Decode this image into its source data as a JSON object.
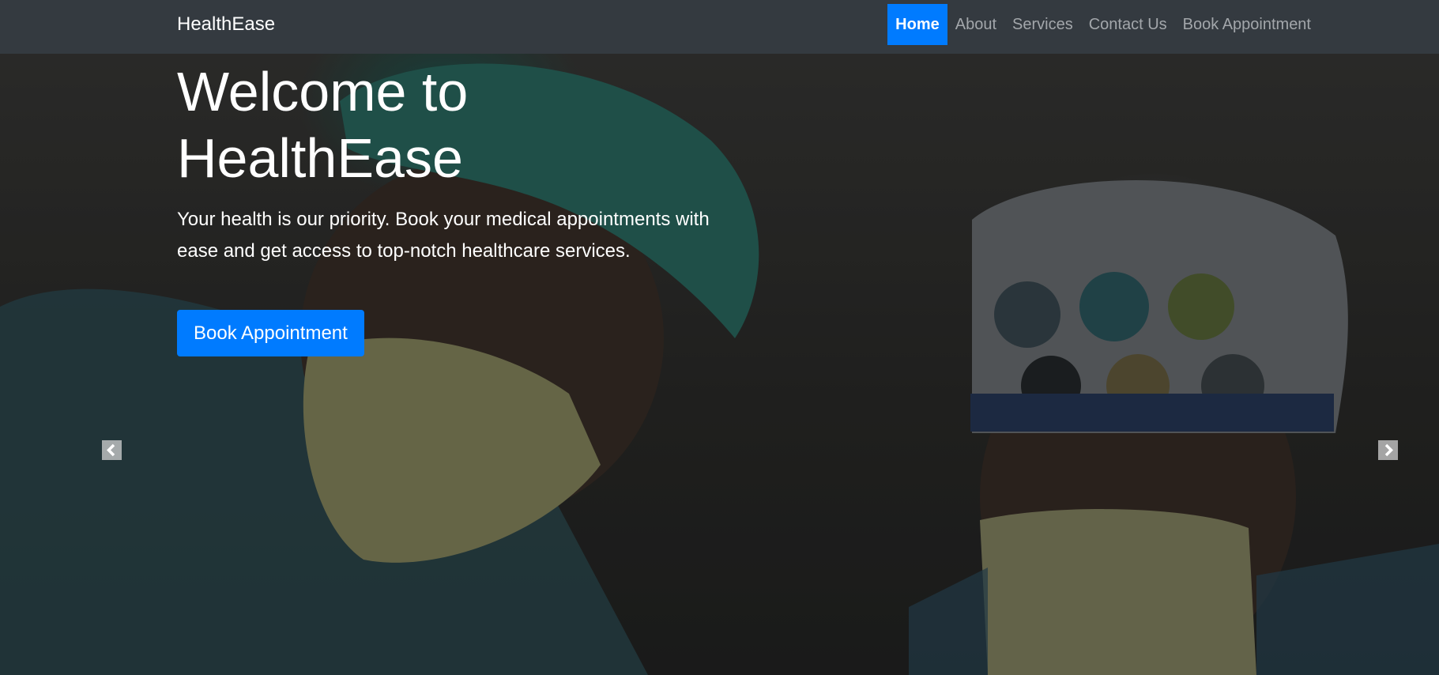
{
  "navbar": {
    "brand": "HealthEase",
    "links": [
      {
        "label": "Home"
      },
      {
        "label": "About"
      },
      {
        "label": "Services"
      },
      {
        "label": "Contact Us"
      },
      {
        "label": "Book Appointment"
      }
    ]
  },
  "hero": {
    "title": "Welcome to HealthEase",
    "subtitle": "Your health is our priority. Book your medical appointments with ease and get access to top-notch healthcare services.",
    "cta_label": "Book Appointment",
    "image_alt": "surgeons-in-operating-room-photo"
  },
  "carousel": {
    "prev_icon": "chevron-left-icon",
    "next_icon": "chevron-right-icon"
  },
  "colors": {
    "navbar_bg": "#343a40",
    "accent": "#007bff",
    "nav_inactive": "#a3a7ab"
  }
}
